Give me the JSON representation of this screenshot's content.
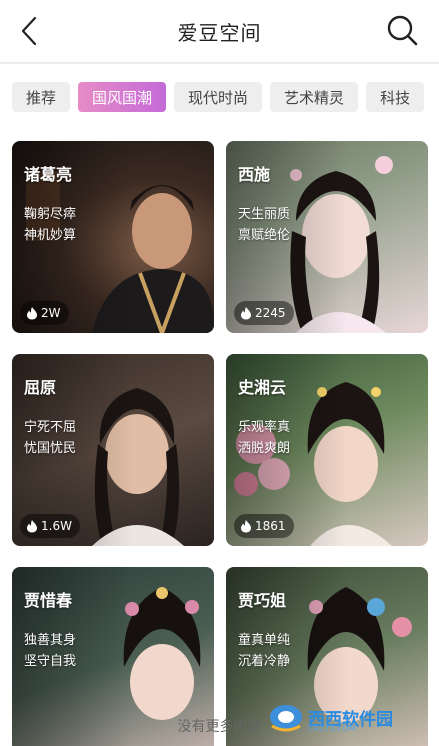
{
  "header": {
    "title": "爱豆空间",
    "back_icon": "chevron-left-icon",
    "search_icon": "search-icon"
  },
  "tabs": [
    {
      "label": "推荐",
      "active": false
    },
    {
      "label": "国风国潮",
      "active": true
    },
    {
      "label": "现代时尚",
      "active": false
    },
    {
      "label": "艺术精灵",
      "active": false
    },
    {
      "label": "科技",
      "active": false
    }
  ],
  "cards": [
    {
      "name": "诸葛亮",
      "tag1": "鞠躬尽瘁",
      "tag2": "神机妙算",
      "heat": "2W"
    },
    {
      "name": "西施",
      "tag1": "天生丽质",
      "tag2": "禀赋绝伦",
      "heat": "2245"
    },
    {
      "name": "屈原",
      "tag1": "宁死不屈",
      "tag2": "忧国忧民",
      "heat": "1.6W"
    },
    {
      "name": "史湘云",
      "tag1": "乐观率真",
      "tag2": "洒脱爽朗",
      "heat": "1861"
    },
    {
      "name": "贾惜春",
      "tag1": "独善其身",
      "tag2": "坚守自我",
      "heat": ""
    },
    {
      "name": "贾巧姐",
      "tag1": "童真单纯",
      "tag2": "沉着冷静",
      "heat": ""
    }
  ],
  "footer": {
    "text": "没有更多内容"
  },
  "watermark": {
    "text": "西西软件园",
    "sub": "CR173.COM"
  }
}
